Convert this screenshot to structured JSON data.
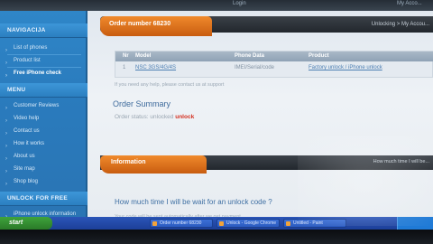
{
  "topbar": {
    "item_1": "Login",
    "item_2": "My Acco..."
  },
  "sidebar": {
    "navigation_title": "NAVIGACIJA",
    "nav_items": [
      {
        "label": "List of phones"
      },
      {
        "label": "Product list"
      },
      {
        "label": "Free iPhone check"
      }
    ],
    "menu_title": "MENU",
    "menu_items": [
      {
        "label": "Customer Reviews"
      },
      {
        "label": "Video help"
      },
      {
        "label": "Contact us"
      },
      {
        "label": "How it works"
      },
      {
        "label": "About us"
      },
      {
        "label": "Site map"
      },
      {
        "label": "Shop blog"
      }
    ],
    "bottom_title": "UNLOCK FOR FREE",
    "bottom_item": "iPhone unlock information"
  },
  "order": {
    "tab_label": "Order number 68230",
    "breadcrumb": "Unlocking > My Accou...",
    "table_headers": [
      "Nr",
      "Model",
      "Phone Data",
      "Product"
    ],
    "row": {
      "nr": "1",
      "model": "NSC 3GS/4G/4S",
      "phone_data": "IMEI/Serial/code",
      "product": "Factory unlock / iPhone unlock"
    },
    "note": "If you need any help, please contact us at support",
    "summary_title": "Order Summary",
    "summary_label": "Order status:",
    "summary_value": "unlocked",
    "summary_status": "unlock"
  },
  "information": {
    "tab_label": "Information",
    "side_note": "How much time I will be...",
    "question": "How much time I will be wait for an unlock code ?",
    "answer": "Your code will be sent automatically after we get payment."
  },
  "taskbar": {
    "start_label": "start",
    "items": [
      {
        "label": "Order number 68230"
      },
      {
        "label": "Unlock - Google Chrome"
      },
      {
        "label": "Untitled - Paint"
      }
    ]
  }
}
